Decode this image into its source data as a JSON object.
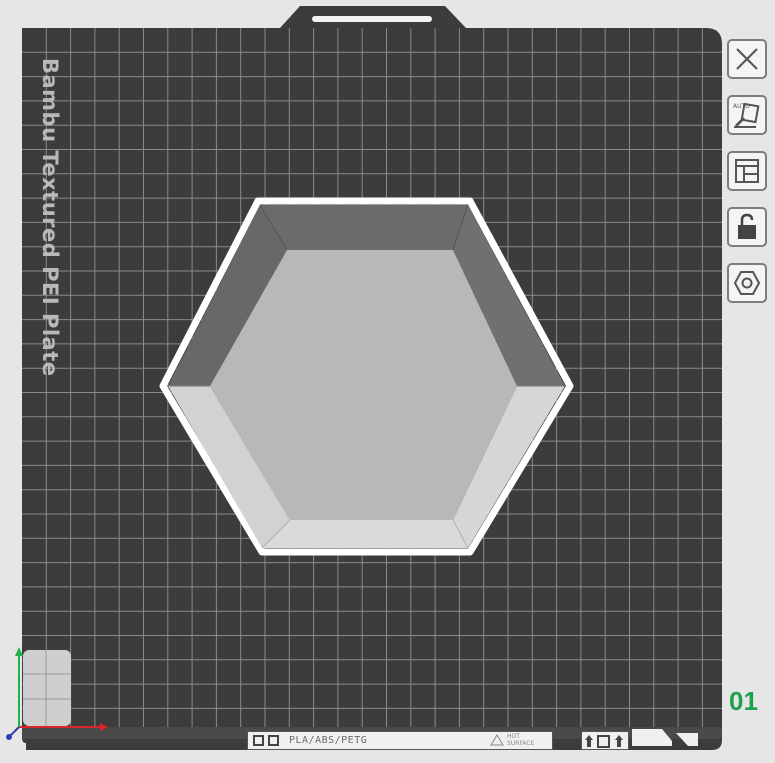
{
  "plate": {
    "label": "Bambu Textured PEI Plate",
    "number": "01",
    "filament_text": "PLA/ABS/PETG",
    "hot_surface_line1": "HOT",
    "hot_surface_line2": "SURFACE"
  },
  "toolbar": {
    "items": [
      {
        "name": "close",
        "icon": "close-icon"
      },
      {
        "name": "auto-orient",
        "icon": "auto-orient-icon",
        "label": "AUTO"
      },
      {
        "name": "arrange",
        "icon": "arrange-icon"
      },
      {
        "name": "lock",
        "icon": "lock-icon"
      },
      {
        "name": "plate-settings",
        "icon": "hexagon-settings-icon"
      }
    ]
  },
  "colors": {
    "plate_bg": "#3c3c3c",
    "grid_line": "#8a8a8a",
    "model_top": "#b8b8b8",
    "model_wall_dark": "#6b6b6b",
    "model_wall_light": "#d6d6d6",
    "selection_outline": "#ffffff",
    "plate_number": "#1fa04f",
    "axis_x": "#d9262c",
    "axis_y": "#22b34a",
    "axis_z": "#2e3fb3"
  }
}
